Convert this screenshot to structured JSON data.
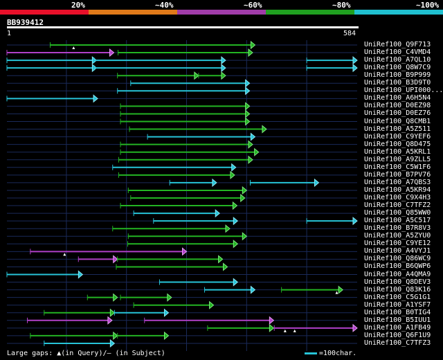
{
  "legend": {
    "labels": [
      "20%",
      "~40%",
      "~60%",
      "~80%",
      "~100%"
    ],
    "colors": [
      "#e8102a",
      "#e07a1a",
      "#a03ca8",
      "#20a020",
      "#20c0d0"
    ]
  },
  "query": {
    "id": "BB939412",
    "start": "1",
    "end": "584",
    "length": 584
  },
  "colors": {
    "green": "#23b423",
    "cyan": "#27c4d8",
    "purple": "#b040c8",
    "grid": "#1a2a5a",
    "arrow_green": "#7de87d",
    "arrow_cyan": "#8ae8f5",
    "arrow_purple": "#e8a0f5"
  },
  "hits": [
    {
      "name": "UniRef100_Q9F713",
      "segments": [
        {
          "start": 73,
          "end": 414,
          "color": "green"
        }
      ],
      "gap_markers": [
        112
      ]
    },
    {
      "name": "UniRef100_C4VMD4",
      "segments": [
        {
          "start": 1,
          "end": 179,
          "color": "purple"
        },
        {
          "start": 186,
          "end": 410,
          "color": "green"
        }
      ]
    },
    {
      "name": "UniRef100_A7QL10",
      "segments": [
        {
          "start": 1,
          "end": 150,
          "color": "cyan"
        },
        {
          "start": 146,
          "end": 365,
          "color": "cyan"
        },
        {
          "start": 500,
          "end": 584,
          "color": "cyan"
        }
      ]
    },
    {
      "name": "UniRef100_Q8W7C9",
      "segments": [
        {
          "start": 1,
          "end": 150,
          "color": "cyan"
        },
        {
          "start": 146,
          "end": 365,
          "color": "cyan"
        },
        {
          "start": 500,
          "end": 584,
          "color": "cyan"
        }
      ]
    },
    {
      "name": "UniRef100_B9P999",
      "segments": [
        {
          "start": 185,
          "end": 320,
          "color": "green"
        },
        {
          "start": 320,
          "end": 365,
          "color": "green"
        }
      ]
    },
    {
      "name": "UniRef100_B3D9T0",
      "segments": [
        {
          "start": 207,
          "end": 405,
          "color": "cyan"
        }
      ]
    },
    {
      "name": "UniRef100_UPI000...",
      "segments": [
        {
          "start": 185,
          "end": 405,
          "color": "cyan"
        }
      ]
    },
    {
      "name": "UniRef100_A6H5N4",
      "segments": [
        {
          "start": 1,
          "end": 152,
          "color": "cyan"
        }
      ]
    },
    {
      "name": "UniRef100_D0EZ98",
      "segments": [
        {
          "start": 190,
          "end": 405,
          "color": "green"
        }
      ]
    },
    {
      "name": "UniRef100_D0EZ76",
      "segments": [
        {
          "start": 190,
          "end": 405,
          "color": "green"
        }
      ]
    },
    {
      "name": "UniRef100_Q8CMB1",
      "segments": [
        {
          "start": 190,
          "end": 405,
          "color": "green"
        }
      ]
    },
    {
      "name": "UniRef100_A5Z511",
      "segments": [
        {
          "start": 205,
          "end": 433,
          "color": "green"
        }
      ]
    },
    {
      "name": "UniRef100_C9YEF6",
      "segments": [
        {
          "start": 235,
          "end": 414,
          "color": "cyan"
        }
      ]
    },
    {
      "name": "UniRef100_Q8D475",
      "segments": [
        {
          "start": 190,
          "end": 410,
          "color": "green"
        }
      ]
    },
    {
      "name": "UniRef100_A5KRL1",
      "segments": [
        {
          "start": 190,
          "end": 420,
          "color": "green"
        }
      ]
    },
    {
      "name": "UniRef100_A9ZLL5",
      "segments": [
        {
          "start": 187,
          "end": 410,
          "color": "green"
        }
      ]
    },
    {
      "name": "UniRef100_C5W1F6",
      "segments": [
        {
          "start": 177,
          "end": 382,
          "color": "cyan"
        }
      ]
    },
    {
      "name": "UniRef100_B7PV76",
      "segments": [
        {
          "start": 187,
          "end": 380,
          "color": "green"
        }
      ]
    },
    {
      "name": "UniRef100_A7QBS3",
      "segments": [
        {
          "start": 272,
          "end": 350,
          "color": "cyan"
        },
        {
          "start": 406,
          "end": 520,
          "color": "cyan"
        }
      ]
    },
    {
      "name": "UniRef100_A5KR94",
      "segments": [
        {
          "start": 203,
          "end": 400,
          "color": "green"
        }
      ]
    },
    {
      "name": "UniRef100_C9X4H3",
      "segments": [
        {
          "start": 207,
          "end": 397,
          "color": "green"
        }
      ]
    },
    {
      "name": "UniRef100_C7TFZ2",
      "segments": [
        {
          "start": 190,
          "end": 384,
          "color": "green"
        }
      ]
    },
    {
      "name": "UniRef100_Q85WW0",
      "segments": [
        {
          "start": 212,
          "end": 355,
          "color": "cyan"
        }
      ]
    },
    {
      "name": "UniRef100_A5C517",
      "segments": [
        {
          "start": 245,
          "end": 385,
          "color": "cyan"
        },
        {
          "start": 500,
          "end": 584,
          "color": "cyan"
        }
      ]
    },
    {
      "name": "UniRef100_B7R8V3",
      "segments": [
        {
          "start": 177,
          "end": 372,
          "color": "green"
        }
      ]
    },
    {
      "name": "UniRef100_A5ZYU0",
      "segments": [
        {
          "start": 203,
          "end": 400,
          "color": "green"
        }
      ]
    },
    {
      "name": "UniRef100_C9YE12",
      "segments": [
        {
          "start": 202,
          "end": 385,
          "color": "green"
        }
      ]
    },
    {
      "name": "UniRef100_A4VYJ1",
      "segments": [
        {
          "start": 40,
          "end": 300,
          "color": "purple"
        }
      ],
      "gap_markers": [
        97
      ]
    },
    {
      "name": "UniRef100_Q86WC9",
      "segments": [
        {
          "start": 120,
          "end": 185,
          "color": "purple"
        },
        {
          "start": 185,
          "end": 360,
          "color": "green"
        }
      ]
    },
    {
      "name": "UniRef100_B6QWP6",
      "segments": [
        {
          "start": 183,
          "end": 368,
          "color": "green"
        }
      ]
    },
    {
      "name": "UniRef100_A4QMA9",
      "segments": [
        {
          "start": 1,
          "end": 127,
          "color": "cyan"
        }
      ]
    },
    {
      "name": "UniRef100_Q8DEV3",
      "segments": [
        {
          "start": 255,
          "end": 385,
          "color": "cyan"
        }
      ]
    },
    {
      "name": "UniRef100_Q83K16",
      "segments": [
        {
          "start": 330,
          "end": 414,
          "color": "cyan"
        },
        {
          "start": 458,
          "end": 560,
          "color": "green"
        }
      ],
      "gap_markers": [
        550
      ]
    },
    {
      "name": "UniRef100_C5G1G1",
      "segments": [
        {
          "start": 135,
          "end": 185,
          "color": "green"
        },
        {
          "start": 190,
          "end": 275,
          "color": "green"
        }
      ]
    },
    {
      "name": "UniRef100_A1YSF7",
      "segments": [
        {
          "start": 212,
          "end": 345,
          "color": "green"
        }
      ]
    },
    {
      "name": "UniRef100_B0TIG4",
      "segments": [
        {
          "start": 63,
          "end": 180,
          "color": "green"
        },
        {
          "start": 180,
          "end": 270,
          "color": "cyan"
        }
      ]
    },
    {
      "name": "UniRef100_B5IUU1",
      "segments": [
        {
          "start": 35,
          "end": 176,
          "color": "purple"
        },
        {
          "start": 230,
          "end": 445,
          "color": "purple"
        }
      ]
    },
    {
      "name": "UniRef100_A1FB49",
      "segments": [
        {
          "start": 335,
          "end": 445,
          "color": "green"
        },
        {
          "start": 446,
          "end": 584,
          "color": "purple"
        }
      ],
      "gap_markers": [
        464,
        480
      ]
    },
    {
      "name": "UniRef100_Q6F1U9",
      "segments": [
        {
          "start": 40,
          "end": 185,
          "color": "green"
        },
        {
          "start": 185,
          "end": 270,
          "color": "green"
        }
      ]
    },
    {
      "name": "UniRef100_C7TFZ3",
      "segments": [
        {
          "start": 63,
          "end": 180,
          "color": "cyan"
        }
      ]
    }
  ],
  "footer": {
    "gaps_label": "Large gaps: ▲(in Query)/– (in Subject)",
    "scale_label": "=100char."
  }
}
